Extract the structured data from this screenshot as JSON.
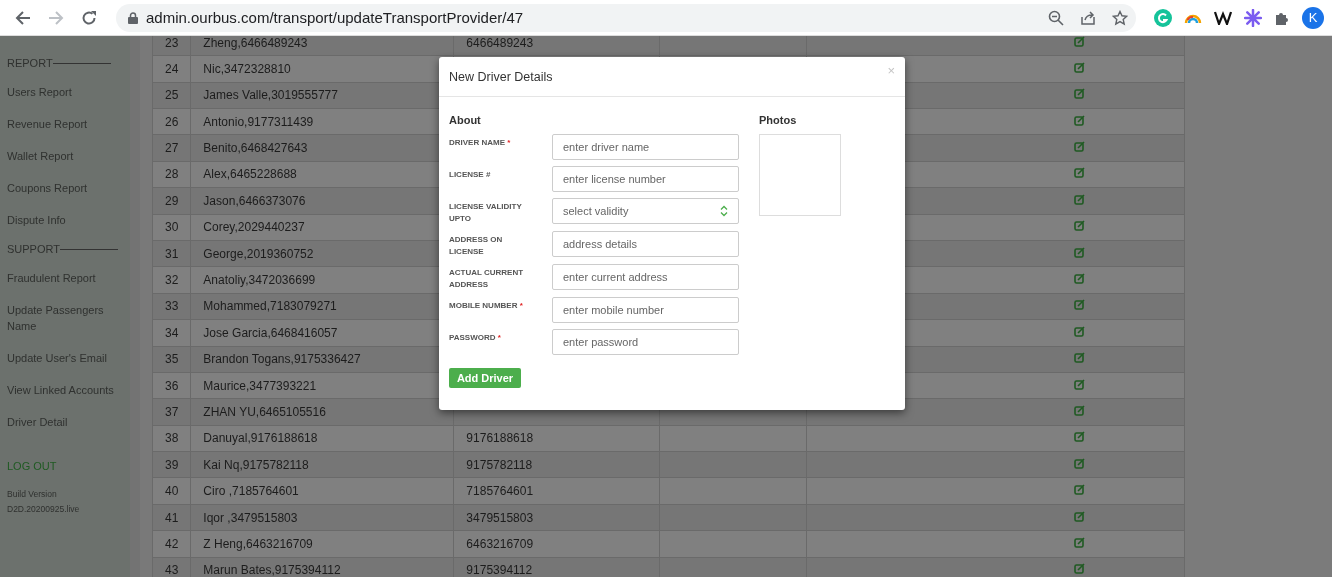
{
  "browser": {
    "url": "admin.ourbus.com/transport/updateTransportProvider/47",
    "profile_initial": "K"
  },
  "sidebar": {
    "sections": [
      {
        "heading": "REPORT",
        "items": [
          "Users Report",
          "Revenue Report",
          "Wallet Report",
          "Coupons Report",
          "Dispute Info"
        ]
      },
      {
        "heading": "SUPPORT",
        "items": [
          "Fraudulent Report",
          "Update Passengers Name",
          "Update User's Email",
          "View Linked Accounts",
          "Driver Detail"
        ]
      }
    ],
    "logout": "LOG OUT",
    "build_label": "Build Version",
    "build_version": "D2D.20200925.live"
  },
  "table": {
    "rows": [
      {
        "number": "23",
        "name": "Zheng,6466489243",
        "phone": "6466489243"
      },
      {
        "number": "24",
        "name": "Nic,3472328810"
      },
      {
        "number": "25",
        "name": "James Valle,3019555777"
      },
      {
        "number": "26",
        "name": "Antonio,9177311439"
      },
      {
        "number": "27",
        "name": "Benito,6468427643"
      },
      {
        "number": "28",
        "name": "Alex,6465228688"
      },
      {
        "number": "29",
        "name": "Jason,6466373076"
      },
      {
        "number": "30",
        "name": "Corey,2029440237"
      },
      {
        "number": "31",
        "name": "George,2019360752"
      },
      {
        "number": "32",
        "name": "Anatoliy,3472036699"
      },
      {
        "number": "33",
        "name": "Mohammed,7183079271"
      },
      {
        "number": "34",
        "name": "Jose Garcia,6468416057"
      },
      {
        "number": "35",
        "name": "Brandon Togans,9175336427"
      },
      {
        "number": "36",
        "name": "Maurice,3477393221"
      },
      {
        "number": "37",
        "name": "ZHAN YU,6465105516"
      },
      {
        "number": "38",
        "name": "Danuyal,9176188618",
        "phone": "9176188618"
      },
      {
        "number": "39",
        "name": "Kai Nq,9175782118",
        "phone": "9175782118"
      },
      {
        "number": "40",
        "name": "Ciro ,7185764601",
        "phone": "7185764601"
      },
      {
        "number": "41",
        "name": "Iqor ,3479515803",
        "phone": "3479515803"
      },
      {
        "number": "42",
        "name": "Z Heng,6463216709",
        "phone": "6463216709"
      },
      {
        "number": "43",
        "name": "Marun Bates,9175394112",
        "phone": "9175394112"
      }
    ]
  },
  "modal": {
    "title": "New Driver Details",
    "close": "×",
    "about_heading": "About",
    "photos_heading": "Photos",
    "submit": "Add Driver",
    "fields": [
      {
        "kind": "text",
        "label": "DRIVER NAME",
        "required_mark": "*",
        "placeholder": "enter driver name"
      },
      {
        "kind": "text",
        "label": "LICENSE #",
        "placeholder": "enter license number"
      },
      {
        "kind": "select",
        "label": "LICENSE VALIDITY UPTO",
        "placeholder": "select validity"
      },
      {
        "kind": "text",
        "label": "ADDRESS ON LICENSE",
        "placeholder": "address details"
      },
      {
        "kind": "text",
        "label": "ACTUAL CURRENT ADDRESS",
        "placeholder": "enter current address"
      },
      {
        "kind": "text",
        "label": "MOBILE NUMBER",
        "required_mark": "*",
        "placeholder": "enter mobile number"
      },
      {
        "kind": "password",
        "label": "PASSWORD",
        "required_mark": "*",
        "placeholder": "enter password"
      }
    ]
  }
}
